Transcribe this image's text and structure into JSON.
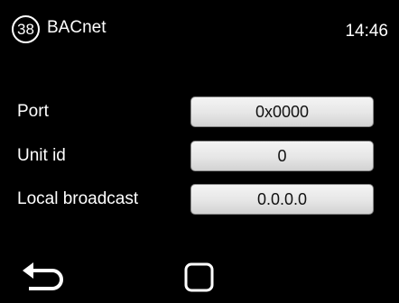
{
  "header": {
    "page_number": "38",
    "title": "BACnet",
    "time": "14:46"
  },
  "settings": [
    {
      "label": "Port",
      "value": "0x0000"
    },
    {
      "label": "Unit id",
      "value": "0"
    },
    {
      "label": "Local broadcast",
      "value": "0.0.0.0"
    }
  ],
  "footer": {
    "back_icon": "back-arrow-icon",
    "home_icon": "square-home-icon"
  },
  "colors": {
    "background": "#000000",
    "text": "#ffffff",
    "button_face": "#e6e6e6",
    "button_text": "#111111"
  }
}
